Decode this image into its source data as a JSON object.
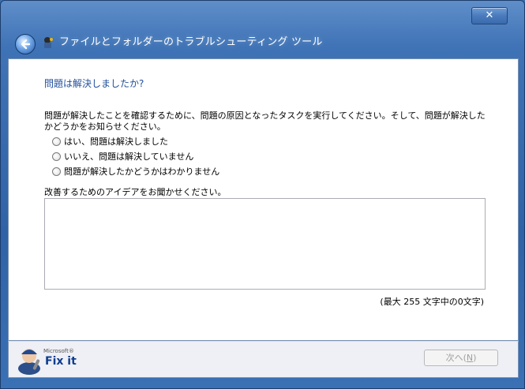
{
  "window": {
    "title": "ファイルとフォルダーのトラブルシューティング ツール",
    "close_glyph": "✕"
  },
  "main": {
    "heading": "問題は解決しましたか?",
    "instruction": "問題が解決したことを確認するために、問題の原因となったタスクを実行してください。そして、問題が解決したかどうかをお知らせください。",
    "options": [
      {
        "label": "はい、問題は解決しました",
        "selected": false
      },
      {
        "label": "いいえ、問題は解決していません",
        "selected": false
      },
      {
        "label": "問題が解決したかどうかはわかりません",
        "selected": false
      }
    ],
    "ideas_label": "改善するためのアイデアをお聞かせください。",
    "ideas_value": "",
    "counter": "(最大 255 文字中の0文字)"
  },
  "footer": {
    "logo_small": "Microsoft®",
    "logo_main": "Fix it",
    "next_label": "次へ(",
    "next_accel": "N",
    "next_suffix": ")"
  },
  "icons": {
    "back": "back-arrow-icon",
    "app": "toolbox-icon",
    "mascot": "fixit-mascot-icon"
  },
  "colors": {
    "title_bar": "#3f73b6",
    "heading": "#1f4e9c",
    "logo": "#0e3d8f",
    "disabled_text": "#a0a0a0"
  }
}
